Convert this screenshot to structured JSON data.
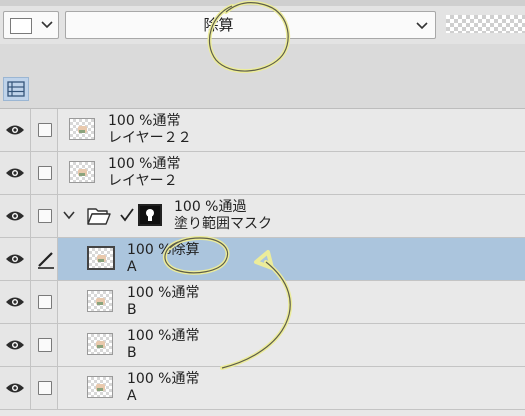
{
  "toolbar": {
    "blend_mode_selected": "除算"
  },
  "layers": [
    {
      "opacity": "100 %",
      "mode": "通常",
      "name": "レイヤー２２",
      "visible": true,
      "selected": false,
      "kind": "raster"
    },
    {
      "opacity": "100 %",
      "mode": "通常",
      "name": "レイヤー２",
      "visible": true,
      "selected": false,
      "kind": "raster"
    },
    {
      "opacity": "100 %",
      "mode": "通過",
      "name": "塗り範囲マスク",
      "visible": true,
      "selected": false,
      "kind": "folder"
    },
    {
      "opacity": "100 %",
      "mode": "除算",
      "name": "A",
      "visible": true,
      "selected": true,
      "kind": "raster"
    },
    {
      "opacity": "100 %",
      "mode": "通常",
      "name": "B",
      "visible": true,
      "selected": false,
      "kind": "raster"
    },
    {
      "opacity": "100 %",
      "mode": "通常",
      "name": "B",
      "visible": true,
      "selected": false,
      "kind": "raster"
    },
    {
      "opacity": "100 %",
      "mode": "通常",
      "name": "A",
      "visible": true,
      "selected": false,
      "kind": "raster"
    }
  ],
  "colors": {
    "selected_row": "#abc5dd",
    "annotation": "#ecec9a"
  }
}
